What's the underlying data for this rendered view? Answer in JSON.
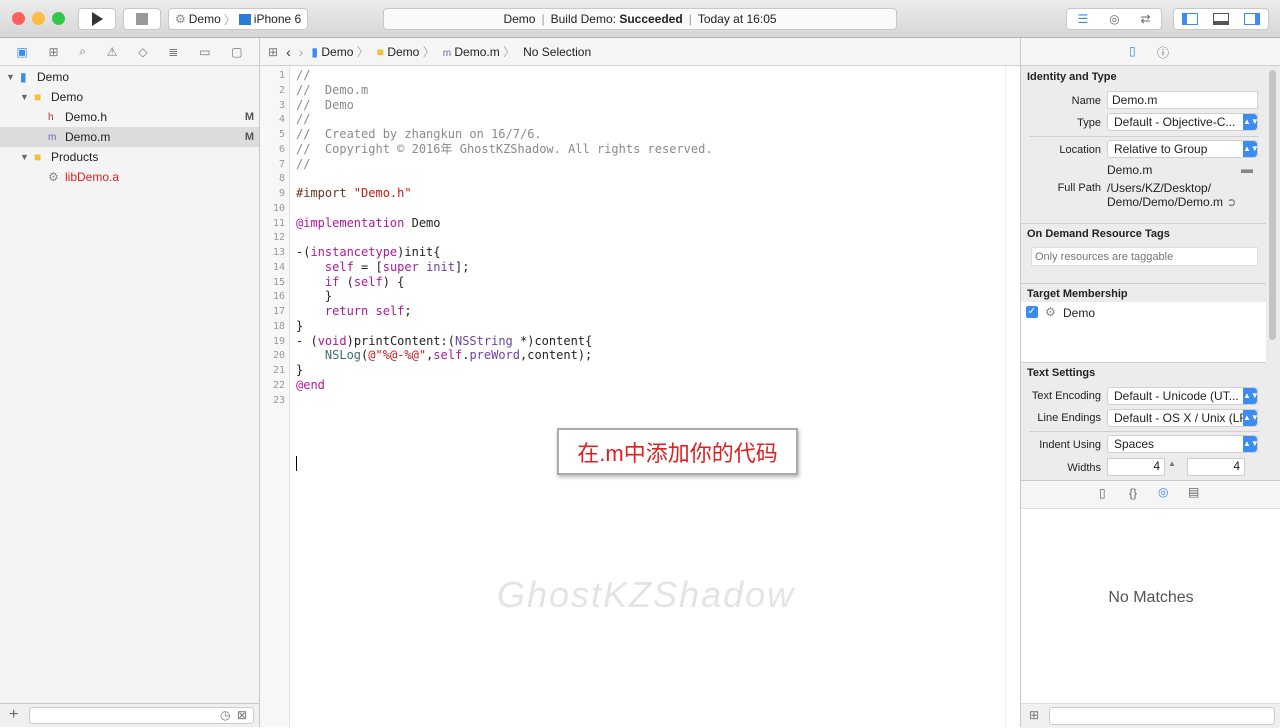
{
  "toolbar": {
    "scheme": "Demo",
    "device": "iPhone 6",
    "status_project": "Demo",
    "status_build": "Build Demo:",
    "status_result": "Succeeded",
    "status_time": "Today at 16:05"
  },
  "jump_bar": {
    "items": [
      "Demo",
      "Demo",
      "Demo.m",
      "No Selection"
    ]
  },
  "navigator": {
    "rows": [
      {
        "label": "Demo",
        "indent": 0,
        "icon": "project-icon",
        "disclosure": true
      },
      {
        "label": "Demo",
        "indent": 1,
        "icon": "folder-icon",
        "disclosure": true
      },
      {
        "label": "Demo.h",
        "indent": 2,
        "icon": "header-file-icon",
        "badge": "M"
      },
      {
        "label": "Demo.m",
        "indent": 2,
        "icon": "impl-file-icon",
        "badge": "M",
        "selected": true
      },
      {
        "label": "Products",
        "indent": 1,
        "icon": "folder-icon",
        "disclosure": true
      },
      {
        "label": "libDemo.a",
        "indent": 2,
        "icon": "library-icon",
        "red": true
      }
    ]
  },
  "editor": {
    "lines": [
      [
        [
          "c",
          "//"
        ]
      ],
      [
        [
          "c",
          "//  Demo.m"
        ]
      ],
      [
        [
          "c",
          "//  Demo"
        ]
      ],
      [
        [
          "c",
          "//"
        ]
      ],
      [
        [
          "c",
          "//  Created by zhangkun on 16/7/6."
        ]
      ],
      [
        [
          "c",
          "//  Copyright © 2016年 GhostKZShadow. All rights reserved."
        ]
      ],
      [
        [
          "c",
          "//"
        ]
      ],
      [],
      [
        [
          "p",
          "#import "
        ],
        [
          "s",
          "\"Demo.h\""
        ]
      ],
      [],
      [
        [
          "k",
          "@implementation"
        ],
        [
          "n",
          " Demo"
        ]
      ],
      [],
      [
        [
          "n",
          "-("
        ],
        [
          "k",
          "instancetype"
        ],
        [
          "n",
          ")init{"
        ]
      ],
      [
        [
          "n",
          "    "
        ],
        [
          "k",
          "self"
        ],
        [
          "n",
          " = ["
        ],
        [
          "k",
          "super"
        ],
        [
          "n",
          " "
        ],
        [
          "t",
          "init"
        ],
        [
          "n",
          "];"
        ]
      ],
      [
        [
          "n",
          "    "
        ],
        [
          "k",
          "if"
        ],
        [
          "n",
          " ("
        ],
        [
          "k",
          "self"
        ],
        [
          "n",
          ") {"
        ]
      ],
      [
        [
          "n",
          "    }"
        ]
      ],
      [
        [
          "n",
          "    "
        ],
        [
          "k",
          "return"
        ],
        [
          "n",
          " "
        ],
        [
          "k",
          "self"
        ],
        [
          "n",
          ";"
        ]
      ],
      [
        [
          "n",
          "}"
        ]
      ],
      [
        [
          "n",
          "- ("
        ],
        [
          "k",
          "void"
        ],
        [
          "n",
          ")printContent:("
        ],
        [
          "t",
          "NSString"
        ],
        [
          "n",
          " *)content{"
        ]
      ],
      [
        [
          "n",
          "    "
        ],
        [
          "m",
          "NSLog"
        ],
        [
          "n",
          "("
        ],
        [
          "s",
          "@\"%@-%@\""
        ],
        [
          "n",
          ","
        ],
        [
          "k",
          "self"
        ],
        [
          "n",
          "."
        ],
        [
          "t",
          "preWord"
        ],
        [
          "n",
          ",content);"
        ]
      ],
      [
        [
          "n",
          "}"
        ]
      ],
      [
        [
          "k",
          "@end"
        ]
      ],
      []
    ]
  },
  "annotation": "在.m中添加你的代码",
  "watermark": "GhostKZShadow",
  "inspector": {
    "identity_title": "Identity and Type",
    "name_label": "Name",
    "name_value": "Demo.m",
    "type_label": "Type",
    "type_value": "Default - Objective-C...",
    "location_label": "Location",
    "location_value": "Relative to Group",
    "location_file": "Demo.m",
    "full_path_label": "Full Path",
    "full_path_1": "/Users/KZ/Desktop/",
    "full_path_2": "Demo/Demo/Demo.m",
    "odr_title": "On Demand Resource Tags",
    "odr_placeholder": "Only resources are taggable",
    "target_title": "Target Membership",
    "target_name": "Demo",
    "target_checked": true,
    "text_title": "Text Settings",
    "encoding_label": "Text Encoding",
    "encoding_value": "Default - Unicode (UT...",
    "endings_label": "Line Endings",
    "endings_value": "Default - OS X / Unix (LF)",
    "indent_label": "Indent Using",
    "indent_value": "Spaces",
    "widths_label": "Widths",
    "tab_width": "4",
    "indent_width": "4",
    "library_empty": "No Matches"
  },
  "colors": {
    "accent": "#3b8cf0",
    "annotation": "#e02020",
    "close": "#fc605c",
    "minimize": "#fdbc40",
    "zoom": "#34c84a"
  }
}
